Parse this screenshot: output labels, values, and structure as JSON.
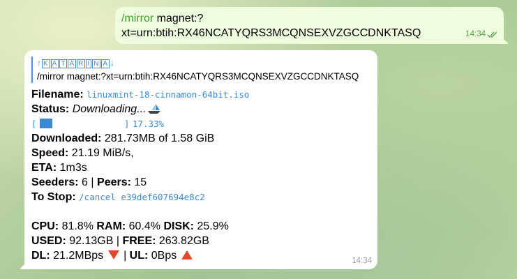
{
  "outgoing": {
    "command": "/mirror",
    "text_rest": " magnet:?",
    "text_line2": "xt=urn:btih:RX46NCATYQRS3MCQNSEXVZGCCDNKTASQ",
    "time": "14:34"
  },
  "incoming": {
    "reply_sender": [
      "K",
      "A",
      "T",
      "A",
      "R",
      "I",
      "N",
      "A"
    ],
    "reply_prefix": "↑",
    "reply_suffix": "↓",
    "reply_text": "/mirror magnet:?xt=urn:btih:RX46NCATYQRS3MCQNSEXVZGCCDNKTASQ",
    "filename_label": "Filename:",
    "filename_value": "linuxmint-18-cinnamon-64bit.iso",
    "status_label": "Status:",
    "status_value": "Downloading...",
    "progress_open": "[",
    "progress_close": "]",
    "progress_percent": "17.33%",
    "progress_fraction": 0.1733,
    "downloaded_label": "Downloaded:",
    "downloaded_value": "281.73MB of 1.58 GiB",
    "speed_label": "Speed:",
    "speed_value": "21.19 MiB/s,",
    "eta_label": "ETA:",
    "eta_value": "1m3s",
    "seeders_label": "Seeders:",
    "seeders_value": "6",
    "sep": "|",
    "peers_label": "Peers:",
    "peers_value": "15",
    "stop_label": "To Stop:",
    "stop_command": "/cancel e39def607694e8c2",
    "cpu_label": "CPU:",
    "cpu_value": "81.8%",
    "ram_label": "RAM:",
    "ram_value": "60.4%",
    "disk_label": "DISK:",
    "disk_value": "25.9%",
    "used_label": "USED:",
    "used_value": "92.13GB",
    "free_label": "FREE:",
    "free_value": "263.82GB",
    "dl_label": "DL:",
    "dl_value": "21.2MBps",
    "ul_label": "UL:",
    "ul_value": "0Bps",
    "time": "14:34",
    "icons": {
      "status_icon": "sailboat-icon",
      "dl_icon": "red-triangle-down-icon",
      "ul_icon": "red-triangle-up-icon"
    }
  },
  "colors": {
    "outgoing_bubble": "#effdde",
    "command_green": "#3b9e27",
    "link_blue": "#3a8ad8",
    "progress_blue": "#3d88d6",
    "triangle_red": "#e2482a"
  }
}
